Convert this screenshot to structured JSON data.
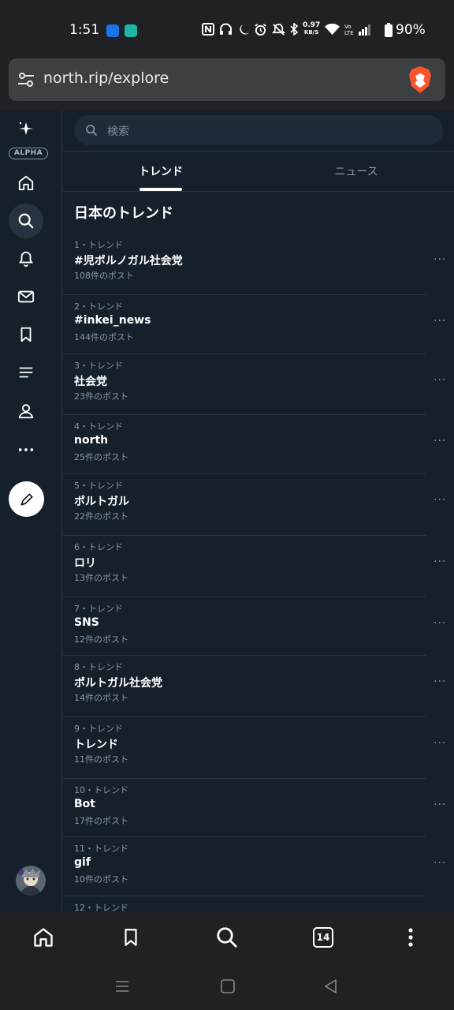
{
  "status_bar": {
    "time": "1:51",
    "net_speed_value": "0.97",
    "net_speed_unit": "KB/S",
    "battery": "90%"
  },
  "browser": {
    "url": "north.rip/explore",
    "tab_count": "14"
  },
  "sidebar": {
    "badge": "ALPHA",
    "items": [
      {
        "icon": "home-icon"
      },
      {
        "icon": "search-icon",
        "active": true
      },
      {
        "icon": "bell-icon"
      },
      {
        "icon": "mail-icon"
      },
      {
        "icon": "bookmark-icon"
      },
      {
        "icon": "list-icon"
      },
      {
        "icon": "profile-icon"
      },
      {
        "icon": "more-icon"
      }
    ]
  },
  "search": {
    "placeholder": "検索"
  },
  "tabs": {
    "trends": "トレンド",
    "news": "ニュース"
  },
  "section_title": "日本のトレンド",
  "trends": [
    {
      "rank": "1・トレンド",
      "name": "#児ポルノガル社会党",
      "count": "108件のポスト"
    },
    {
      "rank": "2・トレンド",
      "name": "#inkei_news",
      "count": "144件のポスト"
    },
    {
      "rank": "3・トレンド",
      "name": "社会党",
      "count": "23件のポスト"
    },
    {
      "rank": "4・トレンド",
      "name": "north",
      "count": "25件のポスト"
    },
    {
      "rank": "5・トレンド",
      "name": "ポルトガル",
      "count": "22件のポスト"
    },
    {
      "rank": "6・トレンド",
      "name": "ロリ",
      "count": "13件のポスト"
    },
    {
      "rank": "7・トレンド",
      "name": "SNS",
      "count": "12件のポスト"
    },
    {
      "rank": "8・トレンド",
      "name": "ポルトガル社会党",
      "count": "14件のポスト"
    },
    {
      "rank": "9・トレンド",
      "name": "トレンド",
      "count": "11件のポスト"
    },
    {
      "rank": "10・トレンド",
      "name": "Bot",
      "count": "17件のポスト"
    },
    {
      "rank": "11・トレンド",
      "name": "gif",
      "count": "10件のポスト"
    },
    {
      "rank": "12・トレンド",
      "name": "",
      "count": ""
    }
  ],
  "colors": {
    "app_background": "#15202b",
    "browser_chrome": "#202124",
    "accent": "#ffffff",
    "muted_text": "#8b98a5"
  }
}
